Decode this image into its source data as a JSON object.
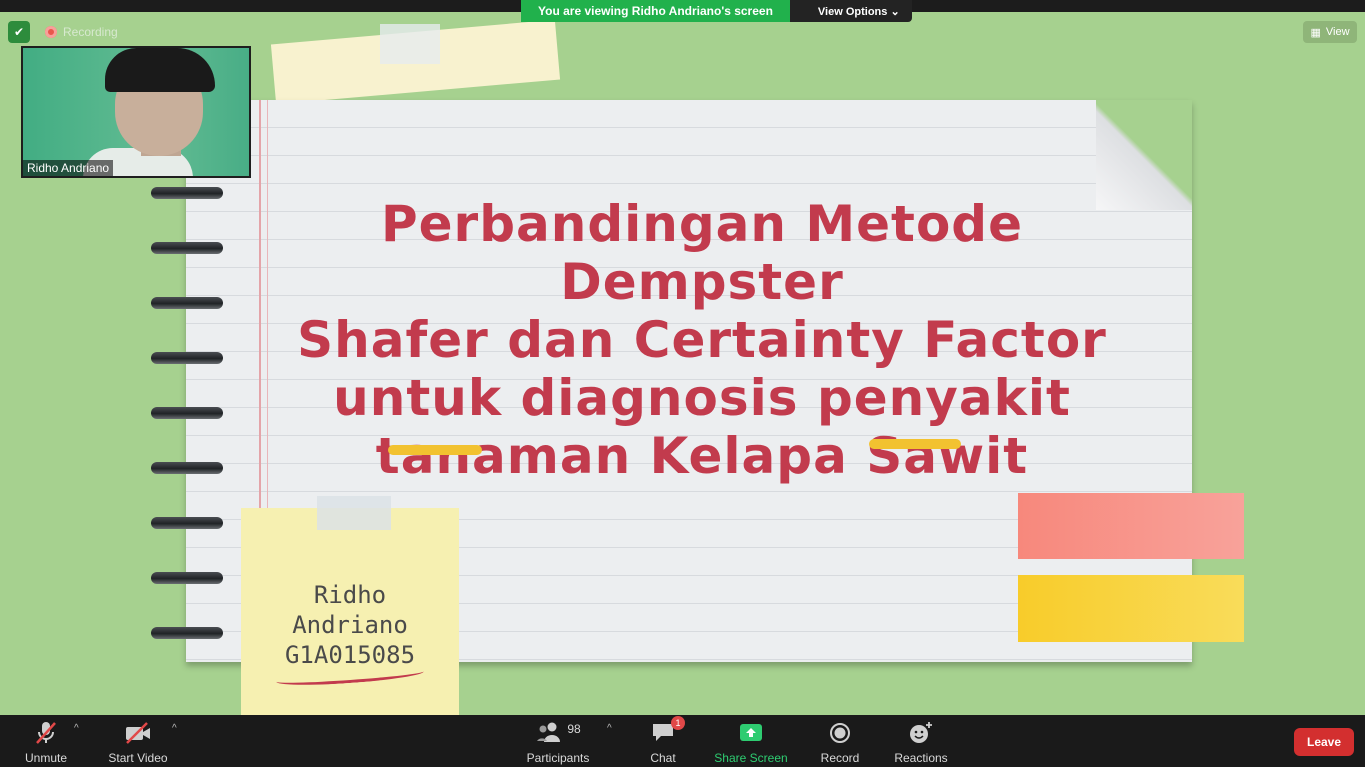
{
  "banner": {
    "recording": "Recording",
    "viewing": "You are viewing Ridho Andriano's screen",
    "view_options": "View Options",
    "view_options_caret": "⌄",
    "view": "View"
  },
  "video": {
    "participant_name": "Ridho Andriano"
  },
  "slide": {
    "title_lines": [
      "Perbandingan Metode Dempster",
      "Shafer dan Certainty Factor",
      "untuk diagnosis penyakit",
      "tanaman Kelapa Sawit"
    ],
    "note_lines": [
      "Ridho",
      "Andriano",
      "G1A015085"
    ],
    "colors": {
      "background": "#a6d18f",
      "title": "#c23b4d",
      "highlight": "#f2c230"
    }
  },
  "toolbar": {
    "unmute": "Unmute",
    "start_video": "Start Video",
    "participants": "Participants",
    "participants_count": "98",
    "chat": "Chat",
    "chat_badge": "1",
    "share_screen": "Share Screen",
    "record": "Record",
    "reactions": "Reactions",
    "leave": "Leave",
    "caret": "^"
  }
}
